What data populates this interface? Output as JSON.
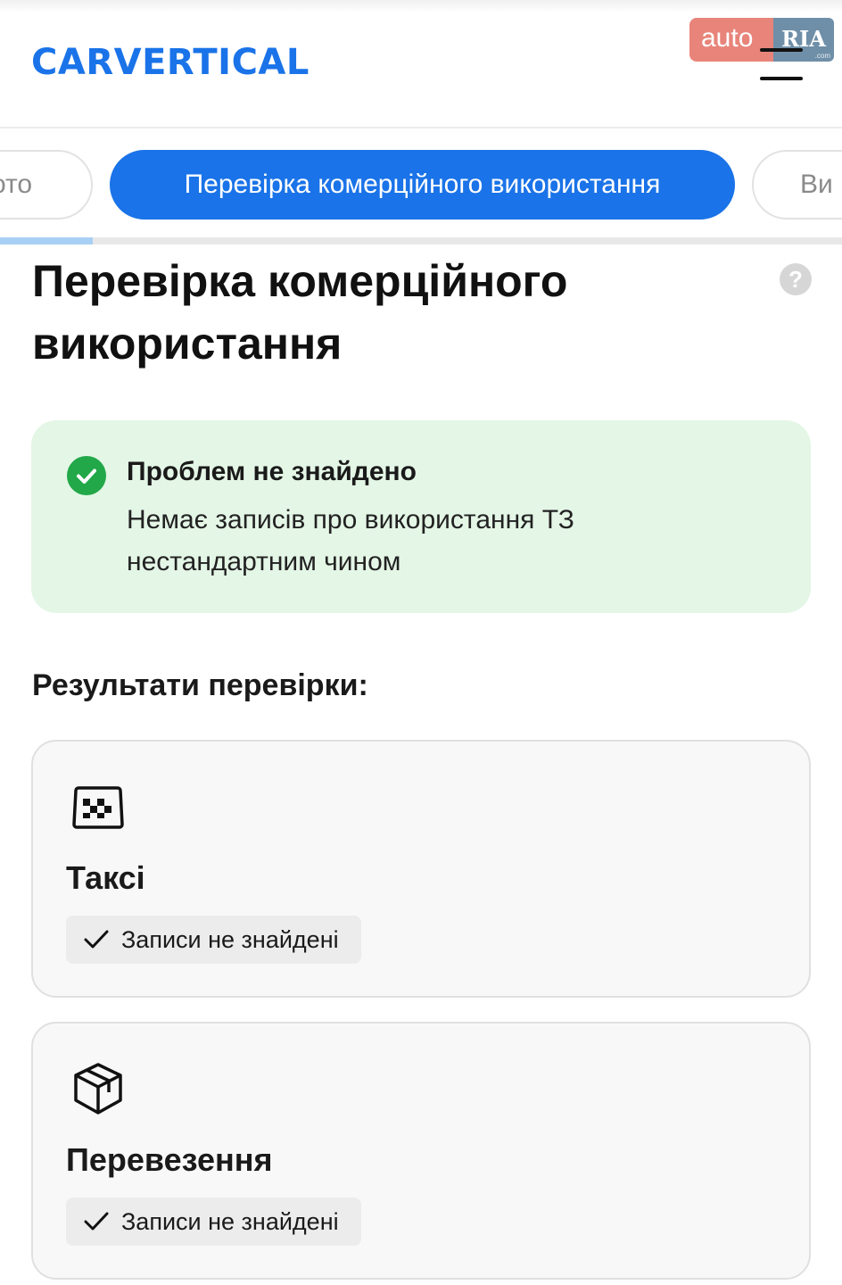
{
  "header": {
    "logo_text": "CARVERTICAL",
    "watermark": {
      "auto": "auto",
      "ria": "RIA",
      "com": ".com"
    },
    "menu_icon": "hamburger-menu-icon"
  },
  "tabs": [
    {
      "label": "Фото",
      "visible_fragment": "ото",
      "active": false
    },
    {
      "label": "Перевірка комерційного використання",
      "active": true
    },
    {
      "label": "Ви",
      "active": false
    }
  ],
  "tab_progress": 0.11,
  "page": {
    "title": "Перевірка комерційного використання",
    "help_icon": "question-circle-icon",
    "help_symbol": "?"
  },
  "status": {
    "icon": "check-circle-icon",
    "title": "Проблем не знайдено",
    "description": "Немає записів про використання ТЗ нестандартним чином",
    "color": "#22a849"
  },
  "results": {
    "heading": "Результати перевірки:",
    "items": [
      {
        "icon": "taxi-icon",
        "title": "Таксі",
        "status_icon": "check-icon",
        "status": "Записи не знайдені"
      },
      {
        "icon": "package-icon",
        "title": "Перевезення",
        "status_icon": "check-icon",
        "status": "Записи не знайдені"
      }
    ]
  },
  "colors": {
    "accent": "#1a73e8",
    "success_bg": "#e4f6e6"
  }
}
